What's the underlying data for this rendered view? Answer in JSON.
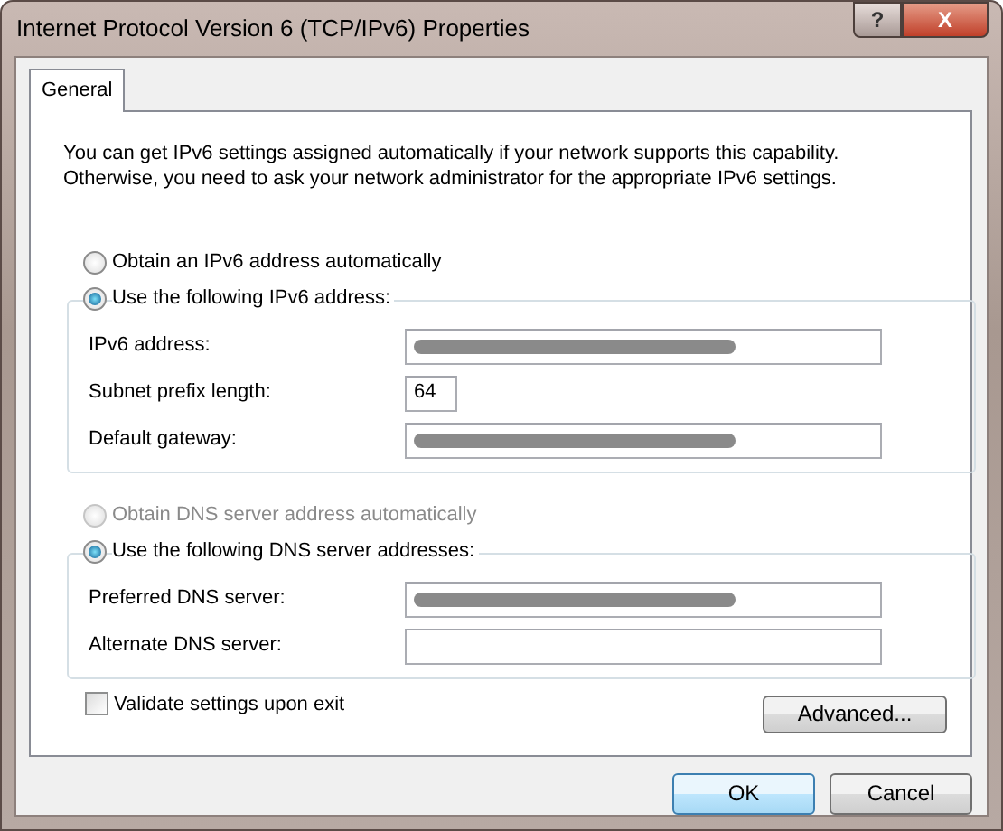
{
  "window": {
    "title": "Internet Protocol Version 6 (TCP/IPv6) Properties",
    "help_button": "?",
    "close_button": "X"
  },
  "tabs": [
    {
      "label": "General",
      "selected": true
    }
  ],
  "description": [
    "You can get IPv6 settings assigned automatically if your network supports this capability.",
    "Otherwise, you need to ask your network administrator for the appropriate IPv6 settings."
  ],
  "sections": [
    {
      "options": [
        {
          "label": "Obtain an IPv6 address automatically",
          "selected": false,
          "disabled": false
        },
        {
          "label": "Use the following IPv6 address:",
          "selected": true,
          "disabled": false
        }
      ],
      "fields": [
        {
          "label": "IPv6 address:",
          "redacted": true,
          "kind": "wide"
        },
        {
          "label": "Subnet prefix length:",
          "value": "64",
          "redacted": false,
          "kind": "short"
        },
        {
          "label": "Default gateway:",
          "redacted": true,
          "kind": "wide"
        }
      ]
    },
    {
      "options": [
        {
          "label": "Obtain DNS server address automatically",
          "selected": false,
          "disabled": true
        },
        {
          "label": "Use the following DNS server addresses:",
          "selected": true,
          "disabled": false
        }
      ],
      "fields": [
        {
          "label": "Preferred DNS server:",
          "redacted": true,
          "kind": "wide"
        },
        {
          "label": "Alternate DNS server:",
          "redacted": false,
          "kind": "wide"
        }
      ]
    }
  ],
  "validate": {
    "label": "Validate settings upon exit",
    "checked": false
  },
  "advanced_button": "Advanced...",
  "buttons": [
    {
      "label": "OK",
      "default": true
    },
    {
      "label": "Cancel",
      "default": false
    }
  ]
}
